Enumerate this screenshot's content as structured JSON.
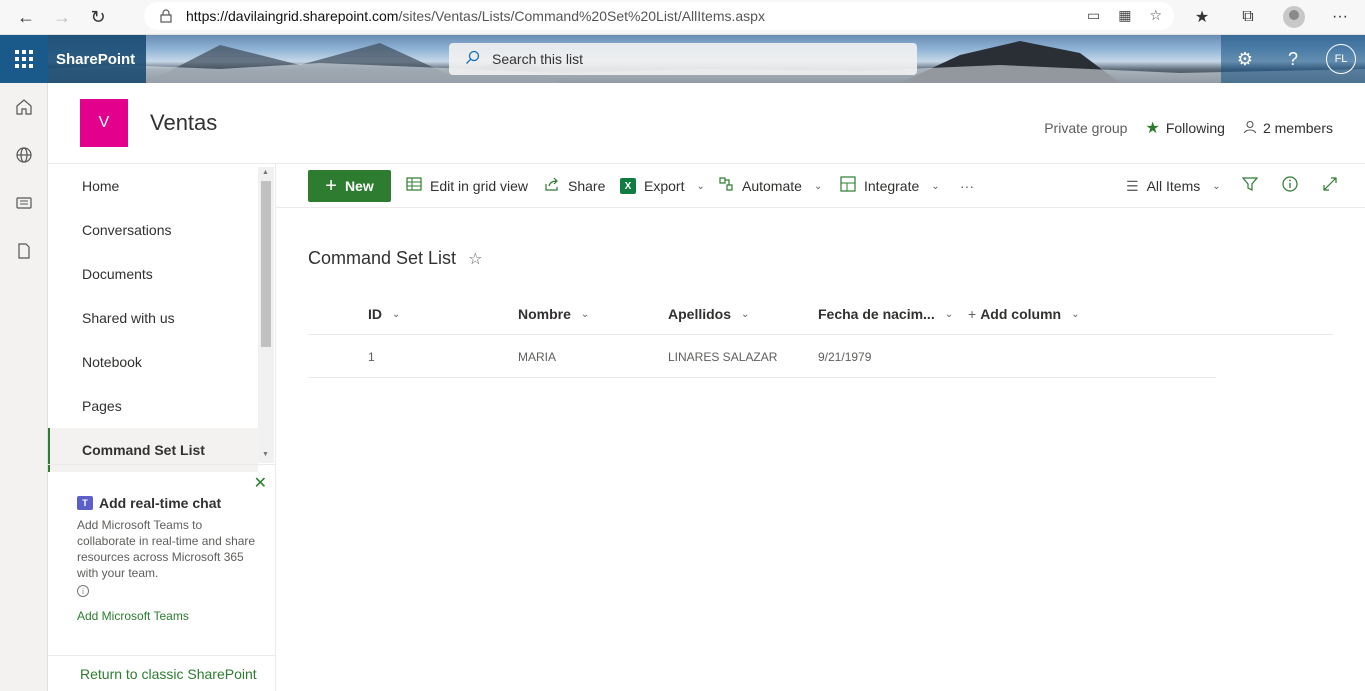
{
  "browser": {
    "url_host": "https://davilaingrid.sharepoint.com",
    "url_path": "/sites/Ventas/Lists/Command%20Set%20List/AllItems.aspx"
  },
  "suite": {
    "app_name": "SharePoint",
    "search_placeholder": "Search this list",
    "user_initials": "FL"
  },
  "site": {
    "logo_letter": "V",
    "title": "Ventas",
    "privacy": "Private group",
    "following": "Following",
    "members": "2 members"
  },
  "nav": {
    "items": [
      {
        "label": "Home"
      },
      {
        "label": "Conversations"
      },
      {
        "label": "Documents"
      },
      {
        "label": "Shared with us"
      },
      {
        "label": "Notebook"
      },
      {
        "label": "Pages"
      },
      {
        "label": "Command Set List"
      }
    ],
    "chat": {
      "title": "Add real-time chat",
      "description": "Add Microsoft Teams to collaborate in real-time and share resources across Microsoft 365 with your team.",
      "link": "Add Microsoft Teams"
    },
    "classic": "Return to classic SharePoint"
  },
  "commands": {
    "new": "New",
    "edit_grid": "Edit in grid view",
    "share": "Share",
    "export": "Export",
    "automate": "Automate",
    "integrate": "Integrate",
    "more": "···",
    "view": "All Items"
  },
  "list": {
    "title": "Command Set List",
    "columns": [
      "ID",
      "Nombre",
      "Apellidos",
      "Fecha de nacim...",
      "Add column"
    ],
    "rows": [
      [
        "1",
        "MARIA",
        "LINARES SALAZAR",
        "9/21/1979"
      ]
    ]
  }
}
